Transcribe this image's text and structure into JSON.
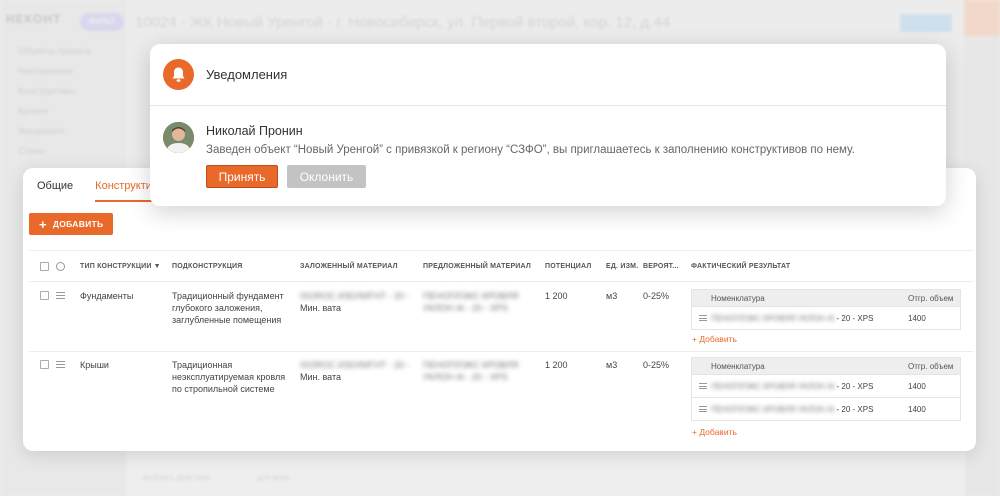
{
  "background": {
    "logo": "НЕКОНТ",
    "pill": "ФИЛЬТ",
    "header_title": "10024 - ЖК Новый Уренгой - г. Новосибирск, ул. Первой второй, кор. 12, д.44",
    "menu": [
      "Объекты проекта",
      "Наставления",
      "Конструктивы",
      "Кровля",
      "Фундамент",
      "Стены"
    ],
    "bottom_left": "выбрать действие",
    "bottom_right": "для всех"
  },
  "notification": {
    "title": "Уведомления",
    "user_name": "Николай Пронин",
    "message": "Заведен объект “Новый Уренгой” с привязкой к региону “СЗФО”, вы приглашаетесь к заполнению конструктивов по нему.",
    "accept_label": "Принять",
    "decline_label": "Оклонить"
  },
  "card": {
    "tabs": [
      "Общие",
      "Конструктивы"
    ],
    "add_button_label": "ДОБАВИТЬ",
    "columns": {
      "type": "ТИП КОНСТРУКЦИИ",
      "sub": "ПОДКОНСТРУКЦИЯ",
      "laid": "ЗАЛОЖЕННЫЙ МАТЕРИАЛ",
      "offered": "ПРЕДЛОЖЕННЫЙ МАТЕРИАЛ",
      "potential": "ПОТЕНЦИАЛ",
      "unit": "ЕД. ИЗМ.",
      "prob": "ВЕРОЯТ...",
      "result": "ФАКТИЧЕСКИЙ РЕЗУЛЬТАТ"
    },
    "sub_headers": {
      "name": "Номенклатура",
      "qty": "Отгр. объем"
    },
    "add_link": "+ Добавить",
    "rows": [
      {
        "type": "Фундаменты",
        "sub": "Традиционный фундамент глубокого заложения, заглубленные помещения",
        "laid_blur": "ISOROC ИЗОЛИГНТ - 20 -",
        "laid_clear": "Мин. вата",
        "offered_1": "ПЕНОПЛЭКС КРОВЛЯ",
        "offered_2": "УКЛОН Al - 20 - XPS",
        "potential": "1 200",
        "unit": "м3",
        "prob": "0-25%",
        "results": [
          {
            "name_blur": "ПЕНОПЛЭКС КРОВЛЯ УКЛОН Al",
            "name_clear": "- 20 - XPS",
            "qty": "1400"
          }
        ]
      },
      {
        "type": "Крыши",
        "sub": "Традиционная неэксплуатируемая кровля по стропильной системе",
        "laid_blur": "ISOROC ИЗОЛИГНТ - 20 -",
        "laid_clear": "Мин. вата",
        "offered_1": "ПЕНОПЛЭКС КРОВЛЯ",
        "offered_2": "УКЛОН Al - 20 - XPS",
        "potential": "1 200",
        "unit": "м3",
        "prob": "0-25%",
        "results": [
          {
            "name_blur": "ПЕНОПЛЭКС КРОВЛЯ УКЛОН Al",
            "name_clear": "- 20 - XPS",
            "qty": "1400"
          },
          {
            "name_blur": "ПЕНОПЛЭКС КРОВЛЯ УКЛОН Al",
            "name_clear": "- 20 - XPS",
            "qty": "1400"
          }
        ]
      }
    ]
  },
  "colors": {
    "accent": "#e8692a",
    "decline": "#c3c3c3"
  }
}
